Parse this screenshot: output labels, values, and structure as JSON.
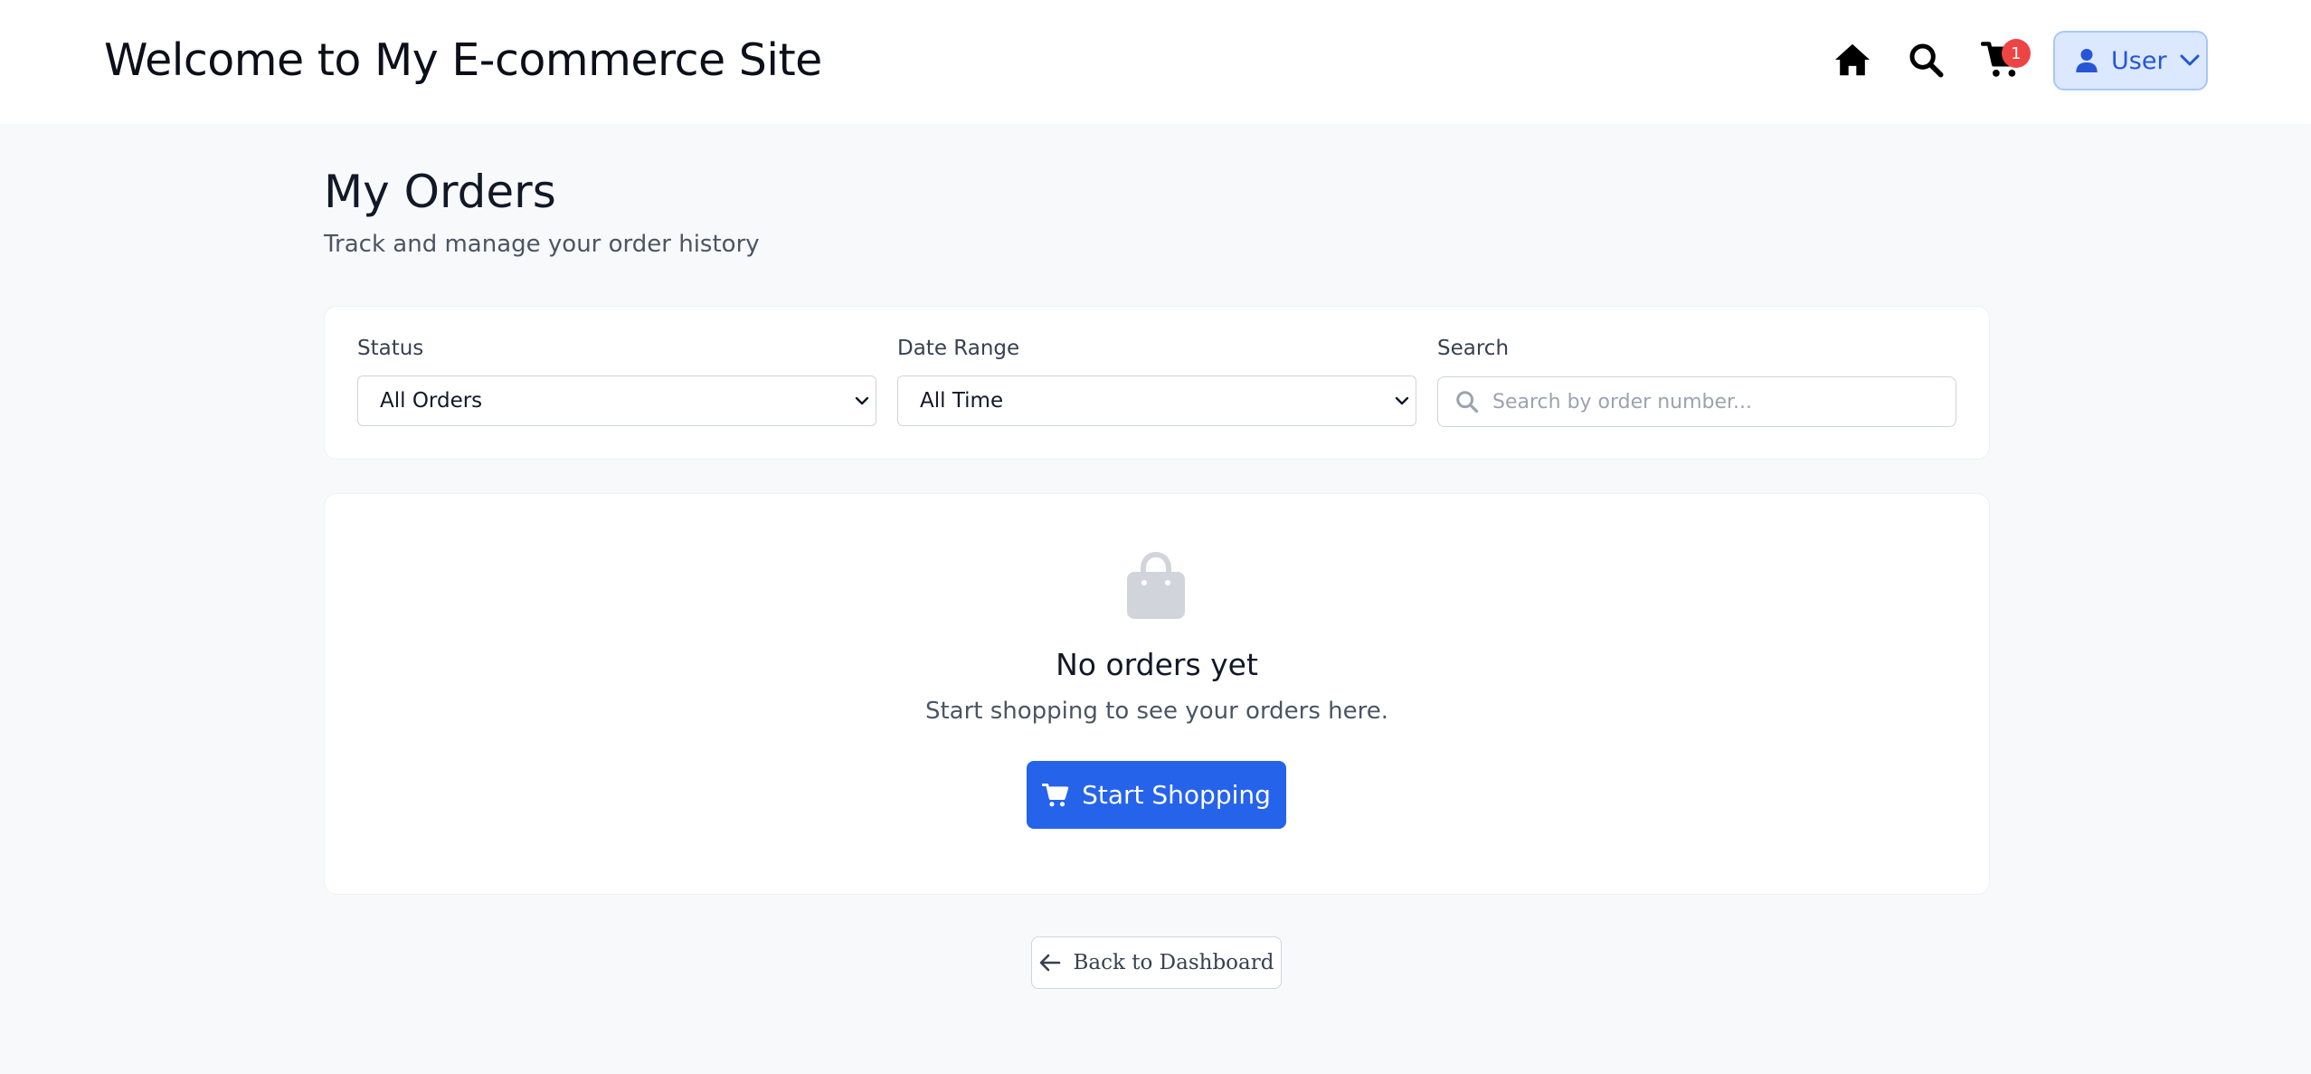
{
  "header": {
    "site_title": "Welcome to My E-commerce Site",
    "cart_count": "1",
    "user_label": "User"
  },
  "page": {
    "title": "My Orders",
    "subtitle": "Track and manage your order history"
  },
  "filters": {
    "status_label": "Status",
    "status_value": "All Orders",
    "date_label": "Date Range",
    "date_value": "All Time",
    "search_label": "Search",
    "search_placeholder": "Search by order number..."
  },
  "empty_state": {
    "title": "No orders yet",
    "message": "Start shopping to see your orders here.",
    "button_label": "Start Shopping"
  },
  "back_button_label": "Back to Dashboard",
  "colors": {
    "primary": "#2563eb",
    "badge": "#ef4444",
    "user_button_bg": "#dbe8fd",
    "page_bg": "#f8f9fb"
  },
  "icons": [
    "home-icon",
    "search-icon",
    "cart-icon",
    "user-icon",
    "chevron-down-icon",
    "shopping-bag-icon",
    "arrow-left-icon"
  ]
}
